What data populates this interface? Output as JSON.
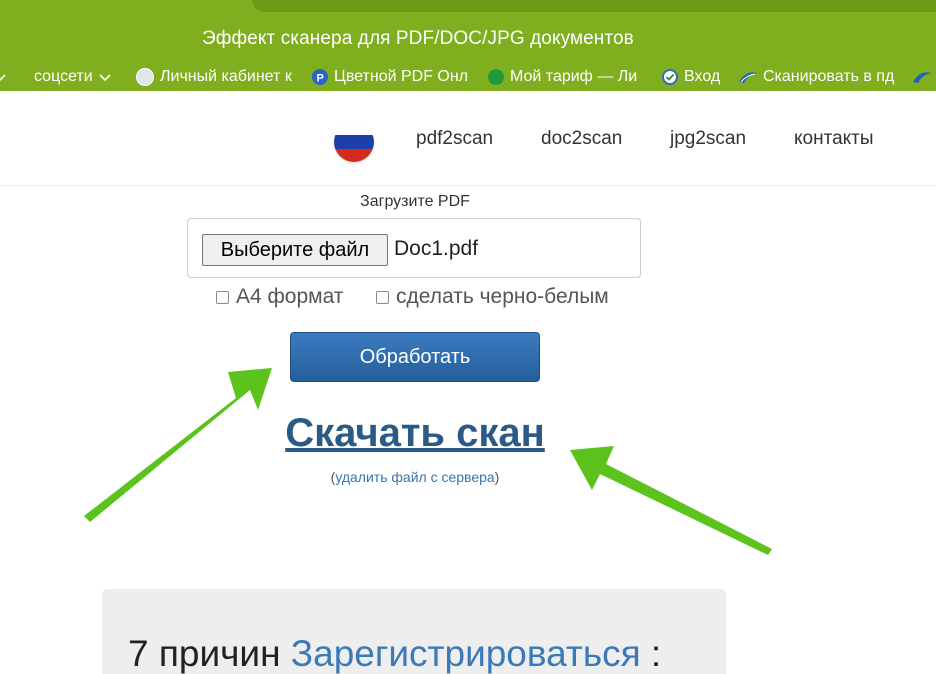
{
  "window": {
    "title": "Эффект сканера для PDF/DOC/JPG документов"
  },
  "bookmarks": [
    {
      "label": "соцсети",
      "icon": "chevron-down-icon"
    },
    {
      "label": "Личный кабинет к",
      "icon": "globe-icon"
    },
    {
      "label": "Цветной PDF Онл",
      "icon": "p-badge-icon"
    },
    {
      "label": "Мой тариф — Ли",
      "icon": "leaf-icon"
    },
    {
      "label": "Вход",
      "icon": "check-circle-icon"
    },
    {
      "label": "Сканировать в пд",
      "icon": "swoosh-icon"
    }
  ],
  "header": {
    "flag_icon": "russia-flag-icon",
    "nav": [
      "pdf2scan",
      "doc2scan",
      "jpg2scan",
      "контакты"
    ]
  },
  "upload": {
    "label": "Загрузите PDF",
    "choose_button": "Выберите файл",
    "file_name": "Doc1.pdf",
    "option_a4": "А4 формат",
    "option_bw": "сделать черно-белым",
    "option_a4_checked": false,
    "option_bw_checked": false
  },
  "actions": {
    "process": "Обработать",
    "download": "Скачать скан",
    "delete_open": "(",
    "delete_link": "удалить файл с сервера",
    "delete_close": ")"
  },
  "reasons": {
    "prefix": "7 причин ",
    "link": "Зарегистрироваться",
    "suffix": " :"
  },
  "colors": {
    "chrome": "#7fae1f",
    "button": "#2f6aa8",
    "link": "#2a5a86",
    "arrow": "#5cc21c"
  }
}
